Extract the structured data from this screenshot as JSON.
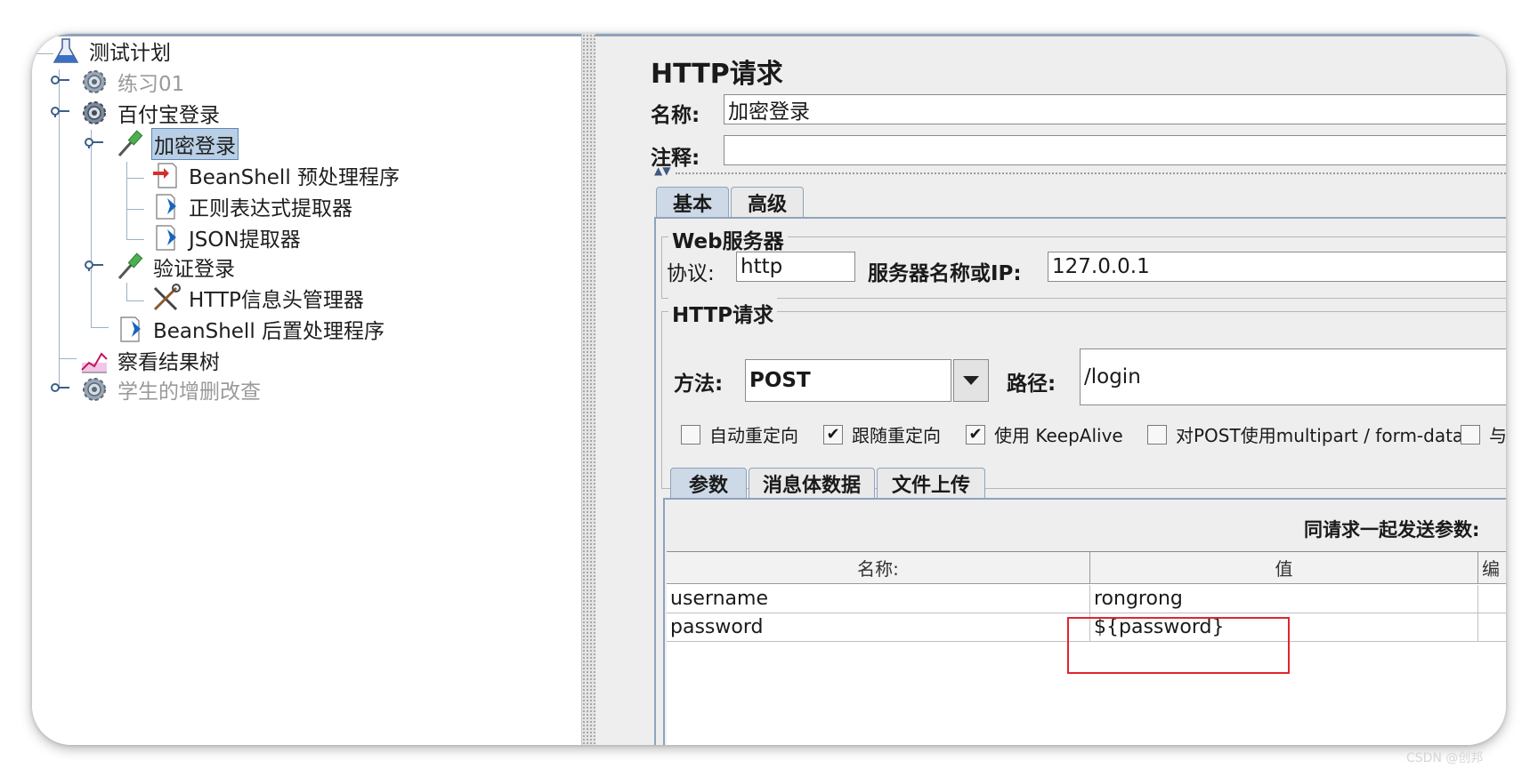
{
  "tree": {
    "nodes": [
      {
        "label": "测试计划"
      },
      {
        "label": "练习01"
      },
      {
        "label": "百付宝登录"
      },
      {
        "label": "加密登录"
      },
      {
        "label": "BeanShell 预处理程序"
      },
      {
        "label": "正则表达式提取器"
      },
      {
        "label": "JSON提取器"
      },
      {
        "label": "验证登录"
      },
      {
        "label": "HTTP信息头管理器"
      },
      {
        "label": "BeanShell 后置处理程序"
      },
      {
        "label": "察看结果树"
      },
      {
        "label": "学生的增删改查"
      }
    ]
  },
  "panel": {
    "title": "HTTP请求",
    "name_label": "名称:",
    "name_value": "加密登录",
    "comment_label": "注释:",
    "comment_value": "",
    "collapse_arrows": "▲▼"
  },
  "tabs": {
    "basic": "基本",
    "advanced": "高级"
  },
  "web_server": {
    "group_label": "Web服务器",
    "protocol_label": "协议:",
    "protocol_value": "http",
    "server_label": "服务器名称或IP:",
    "server_value": "127.0.0.1"
  },
  "http_request": {
    "group_label": "HTTP请求",
    "method_label": "方法:",
    "method_value": "POST",
    "path_label": "路径:",
    "path_value": "/login"
  },
  "options": [
    {
      "label": "自动重定向",
      "checked": false,
      "mark": ""
    },
    {
      "label": "跟随重定向",
      "checked": true,
      "mark": "✔"
    },
    {
      "label": "使用 KeepAlive",
      "checked": true,
      "mark": "✔"
    },
    {
      "label": "对POST使用multipart / form-data",
      "checked": false,
      "mark": ""
    },
    {
      "label": "与",
      "checked": false,
      "mark": ""
    }
  ],
  "sub_tabs": {
    "params": "参数",
    "body": "消息体数据",
    "upload": "文件上传"
  },
  "params_table": {
    "caption": "同请求一起发送参数:",
    "columns": [
      "名称:",
      "值",
      "编"
    ],
    "rows": [
      {
        "name": "username",
        "value": "rongrong"
      },
      {
        "name": "password",
        "value": "${password}"
      }
    ]
  },
  "watermark": "CSDN @创邦",
  "colors": {
    "highlight_box": "#e0252c",
    "tab_active": "#cdd9e6",
    "selection": "#b8cfe5"
  }
}
